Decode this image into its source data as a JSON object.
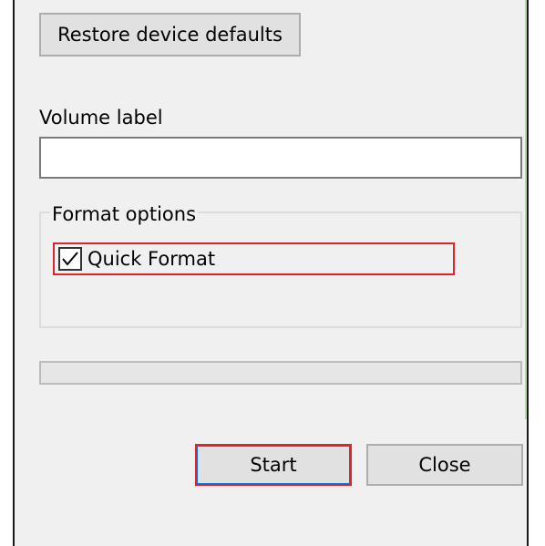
{
  "dialog": {
    "restore_defaults_label": "Restore device defaults",
    "volume_label": {
      "label": "Volume label",
      "value": ""
    },
    "format_options": {
      "group_label": "Format options",
      "quick_format": {
        "label": "Quick Format",
        "checked": true
      }
    },
    "progress": {
      "value": 0
    },
    "buttons": {
      "start_label": "Start",
      "close_label": "Close"
    }
  },
  "colors": {
    "dialog_background": "#f0f0f0",
    "button_face": "#e1e1e1",
    "highlight_red": "#e0242b",
    "focus_blue": "#0078d7",
    "progress_green": "#06b025"
  },
  "icons": {
    "checkmark": "checkmark-icon"
  }
}
